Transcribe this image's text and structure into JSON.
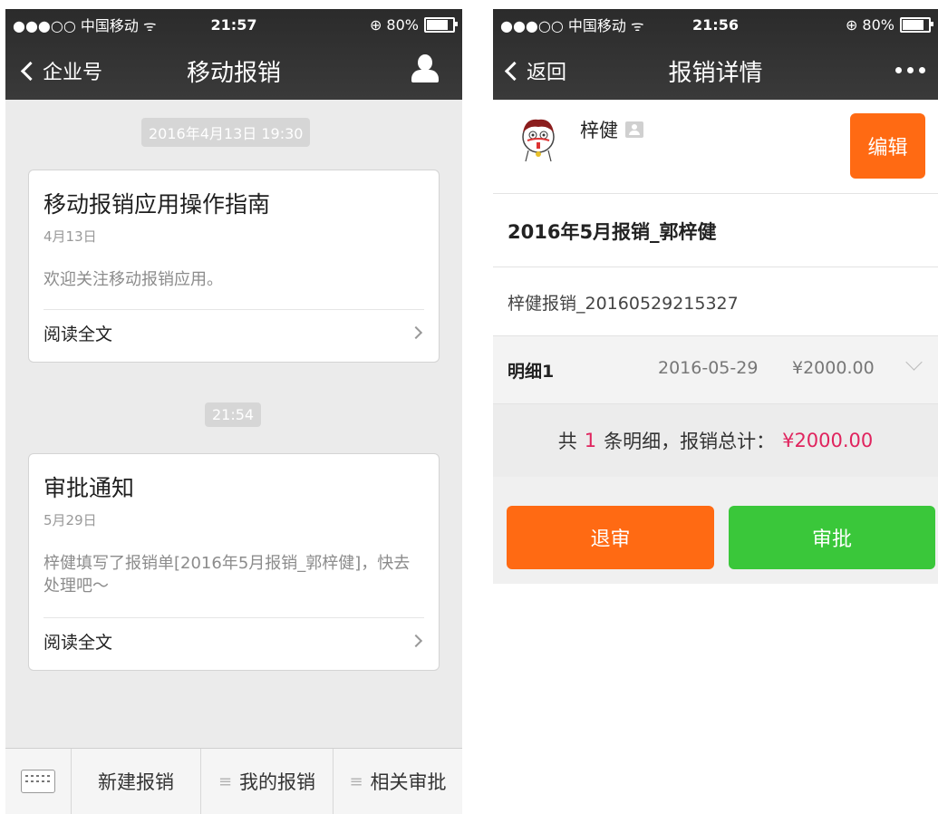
{
  "left": {
    "status": {
      "carrier": "●●●○○ 中国移动 ᯤ",
      "time": "21:57",
      "battery": "⊕ 80%"
    },
    "nav": {
      "back_label": "企业号",
      "title": "移动报销"
    },
    "timestamps": [
      "2016年4月13日 19:30",
      "21:54"
    ],
    "cards": [
      {
        "title": "移动报销应用操作指南",
        "date": "4月13日",
        "body": "欢迎关注移动报销应用。",
        "link": "阅读全文"
      },
      {
        "title": "审批通知",
        "date": "5月29日",
        "body": "梓健填写了报销单[2016年5月报销_郭梓健]，快去处理吧～",
        "link": "阅读全文"
      }
    ],
    "bottom": {
      "new_label": "新建报销",
      "mine_label": "我的报销",
      "related_label": "相关审批",
      "menu_prefix": "≡"
    }
  },
  "right": {
    "status": {
      "carrier": "●●●○○ 中国移动 ᯤ",
      "time": "21:56",
      "battery": "⊕ 80%"
    },
    "nav": {
      "back_label": "返回",
      "title": "报销详情"
    },
    "user": {
      "name": "梓健"
    },
    "edit_label": "编辑",
    "report_title": "2016年5月报销_郭梓健",
    "report_code": "梓健报销_20160529215327",
    "detail": {
      "label": "明细1",
      "date": "2016-05-29",
      "amount": "¥2000.00"
    },
    "summary": {
      "prefix": "共",
      "count": "1",
      "mid": "条明细，报销总计：",
      "total": "¥2000.00"
    },
    "reject_label": "退审",
    "approve_label": "审批"
  },
  "colors": {
    "orange": "#ff6a13",
    "green": "#3ac73a",
    "red_text": "#e0245e",
    "dark_bar": "#333333"
  }
}
